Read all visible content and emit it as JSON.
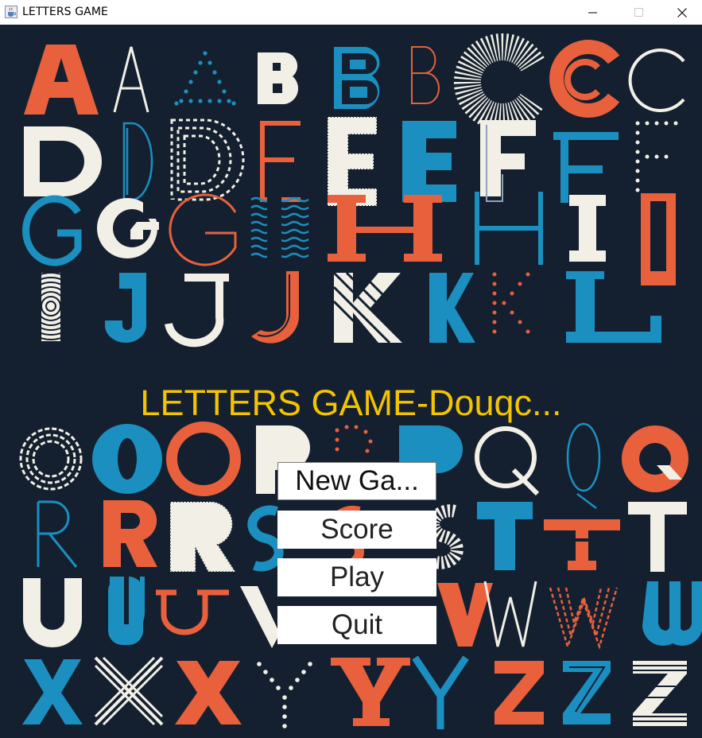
{
  "window": {
    "title": "LETTERS GAME",
    "minimize_icon": "minimize-icon",
    "maximize_icon": "maximize-icon",
    "close_icon": "close-icon",
    "app_icon": "java-cup-icon"
  },
  "content": {
    "game_title": "LETTERS GAME-Douqc...",
    "background_color": "#14202f",
    "title_color": "#f5c400",
    "palette": {
      "orange": "#e8603c",
      "blue": "#1b8fc0",
      "cream": "#f2efe6"
    }
  },
  "menu": {
    "new_game": "New Ga...",
    "score": "Score",
    "play": "Play",
    "quit": "Quit"
  }
}
